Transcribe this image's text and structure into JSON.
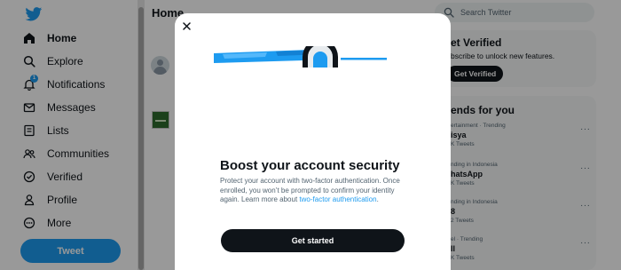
{
  "sidebar": {
    "items": [
      {
        "label": "Home",
        "icon": "home-icon"
      },
      {
        "label": "Explore",
        "icon": "search-icon"
      },
      {
        "label": "Notifications",
        "icon": "bell-icon",
        "badge": "1"
      },
      {
        "label": "Messages",
        "icon": "envelope-icon"
      },
      {
        "label": "Lists",
        "icon": "list-icon"
      },
      {
        "label": "Communities",
        "icon": "people-icon"
      },
      {
        "label": "Verified",
        "icon": "verified-icon"
      },
      {
        "label": "Profile",
        "icon": "person-icon"
      },
      {
        "label": "More",
        "icon": "more-circle-icon"
      }
    ],
    "tweet_label": "Tweet"
  },
  "main": {
    "title": "Home"
  },
  "search": {
    "placeholder": "Search Twitter"
  },
  "verified_panel": {
    "title": "et Verified",
    "subtitle": "bscribe to unlock new features.",
    "button": "Get Verified"
  },
  "trends": {
    "title": "ends for you",
    "items": [
      {
        "context": "ertainment · Trending",
        "name": "isya",
        "count": "K Tweets"
      },
      {
        "context": "nding in Indonesia",
        "name": "hatsApp",
        "count": "K Tweets"
      },
      {
        "context": "nding in Indonesia",
        "name": "8",
        "count": "2 Tweets"
      },
      {
        "context": "el · Trending",
        "name": "ll",
        "count": "K Tweets"
      }
    ],
    "more_glyph": "···"
  },
  "modal": {
    "close_glyph": "✕",
    "title": "Boost your account security",
    "description": "Protect your account with two-factor authentication. Once enrolled, you won’t be prompted to confirm your identity again. Learn more about ",
    "link": "two-factor authentication",
    "period": ".",
    "button": "Get started"
  },
  "colors": {
    "brand": "#1d9bf0",
    "text": "#0f1419",
    "secondary": "#536471",
    "overlay": "rgba(0,0,0,0.4)"
  }
}
